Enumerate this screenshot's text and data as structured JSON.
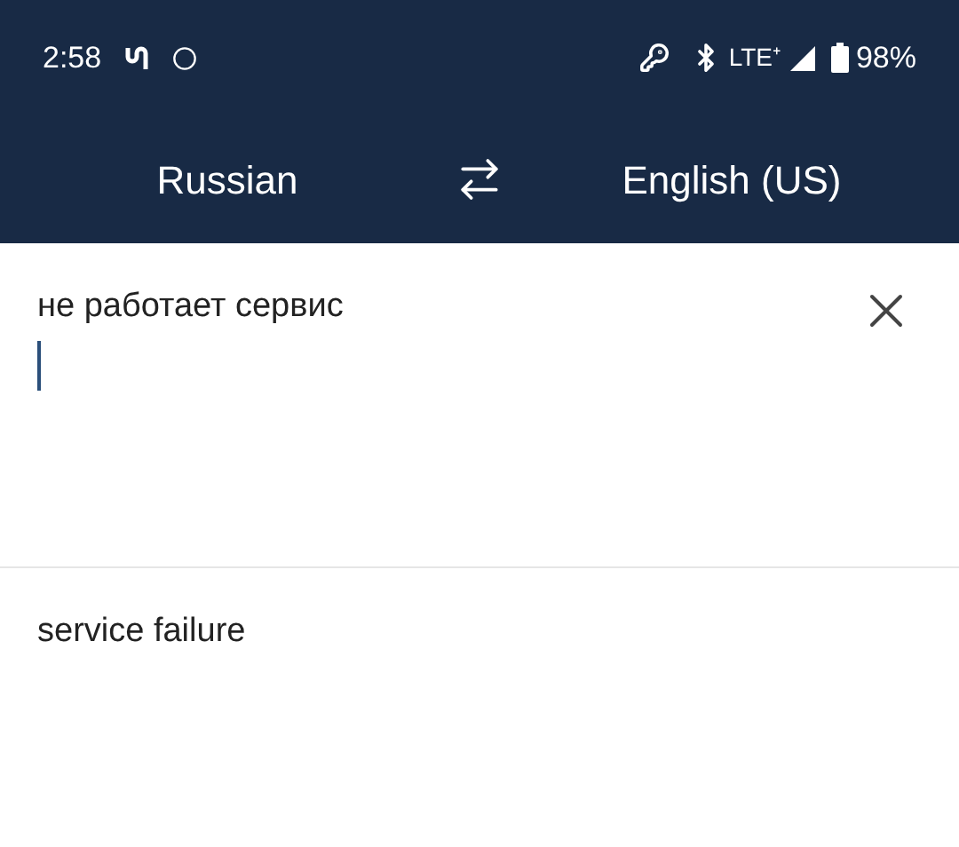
{
  "status_bar": {
    "time": "2:58",
    "network": "LTE⁺",
    "battery": "98%"
  },
  "languages": {
    "source": "Russian",
    "target": "English (US)"
  },
  "input": {
    "value": "не работает сервис",
    "focused": true
  },
  "output": {
    "text": "service failure"
  }
}
